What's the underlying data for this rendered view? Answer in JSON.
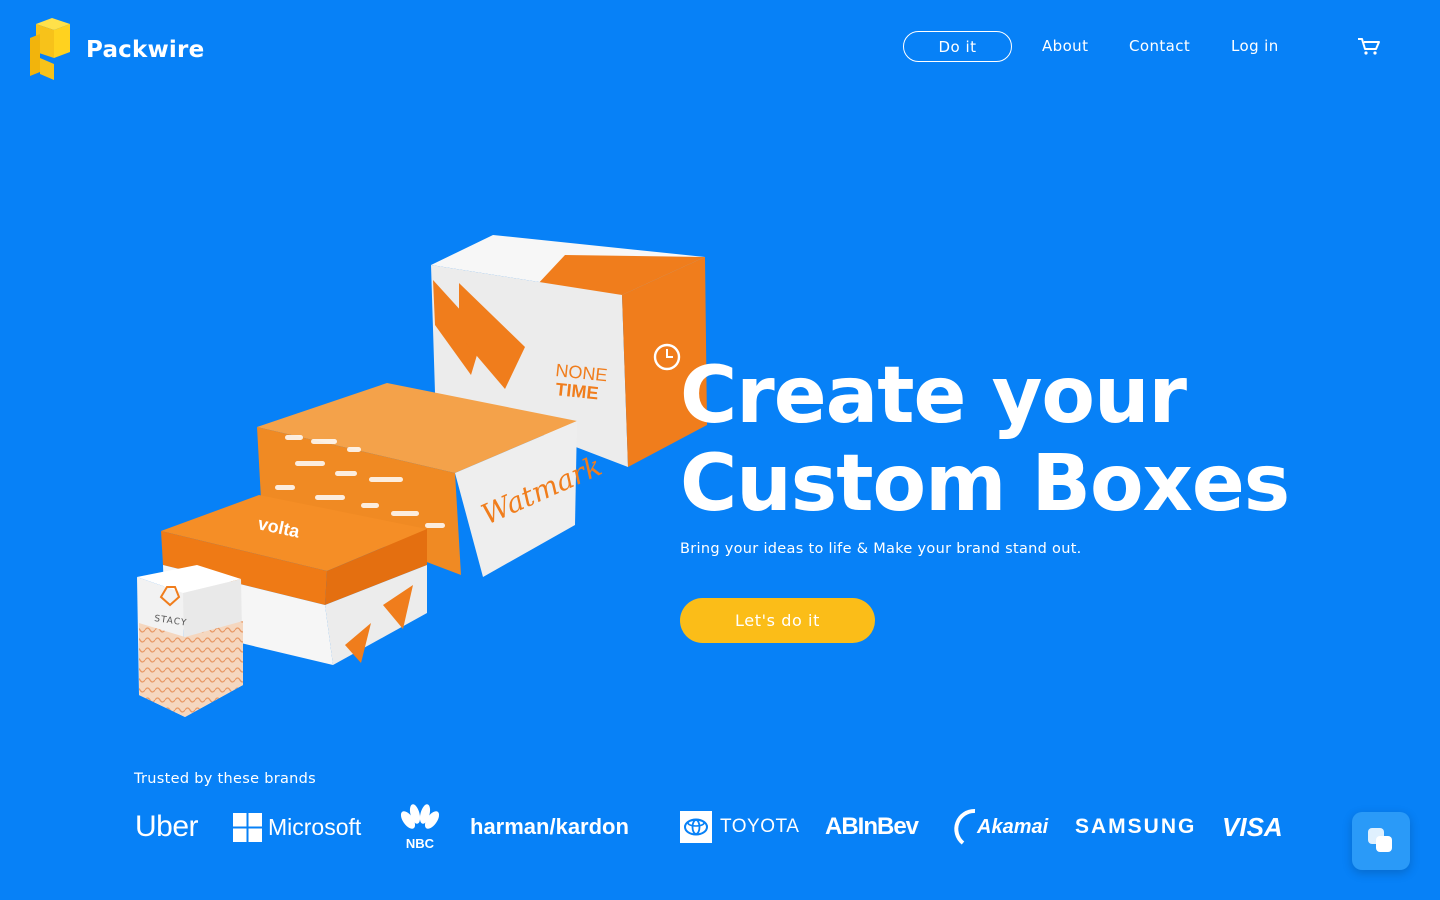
{
  "brand": {
    "name": "Packwire",
    "logo_icon": "packwire-logo-icon"
  },
  "nav": {
    "cta_label": "Do it",
    "links": [
      "About",
      "Contact",
      "Log in"
    ],
    "cart_icon": "cart-icon"
  },
  "hero": {
    "title_line1": "Create your",
    "title_line2": "Custom Boxes",
    "subtitle": "Bring your ideas to life & Make your brand stand out.",
    "cta_label": "Let's do it",
    "illustration_boxes": {
      "box1": [
        "NONE",
        "TIME"
      ],
      "box2": "Watmark",
      "box3": "volta",
      "box4": "STACY"
    }
  },
  "brands": {
    "label": "Trusted by these brands",
    "logos": [
      "Uber",
      "Microsoft",
      "NBC",
      "harman/kardon",
      "TOYOTA",
      "ABInBev",
      "Akamai",
      "SAMSUNG",
      "VISA"
    ]
  },
  "chat_icon": "chat-bubble-icon",
  "colors": {
    "background": "#0781f7",
    "accent": "#fbbd18",
    "box_orange": "#f07d1c"
  }
}
